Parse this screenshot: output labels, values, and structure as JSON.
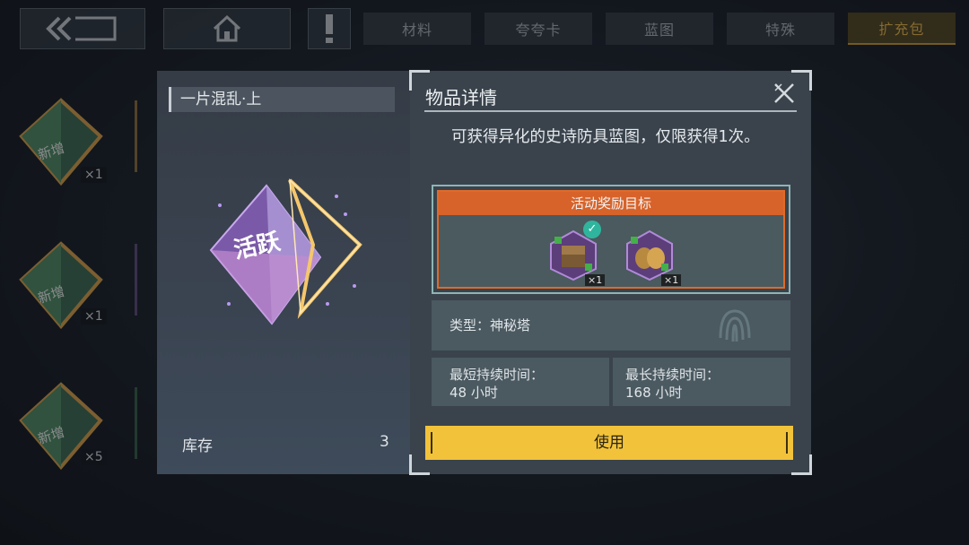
{
  "topbar": {
    "back_icon": "double-chevron-left-icon",
    "home_icon": "home-icon",
    "alert_icon": "exclamation-icon",
    "tabs": [
      {
        "label": "材料",
        "active": false
      },
      {
        "label": "夸夸卡",
        "active": false
      },
      {
        "label": "蓝图",
        "active": false
      },
      {
        "label": "特殊",
        "active": false
      },
      {
        "label": "扩充包",
        "active": true
      }
    ]
  },
  "background_items": [
    {
      "badge": "新增",
      "qty": "×1"
    },
    {
      "badge": "新增",
      "qty": "×1"
    },
    {
      "badge": "新增",
      "qty": "×5"
    }
  ],
  "item_panel": {
    "name": "一片混乱·上",
    "emblem_text": "活跃",
    "stock_label": "库存",
    "stock_value": "3"
  },
  "detail": {
    "title": "物品详情",
    "close_icon": "close-icon",
    "description": "可获得异化的史诗防具蓝图，仅限获得1次。",
    "reward_header": "活动奖励目标",
    "rewards": [
      {
        "qty": "×1",
        "claimed": true
      },
      {
        "qty": "×1",
        "claimed": false
      }
    ],
    "type_text": "类型：神秘塔",
    "min_duration_label": "最短持续时间：",
    "min_duration_value": "48 小时",
    "max_duration_label": "最长持续时间：",
    "max_duration_value": "168 小时",
    "use_label": "使用"
  },
  "colors": {
    "accent_orange": "#d7632a",
    "use_button": "#f2c23a",
    "active_tab": "#e8b64a"
  }
}
